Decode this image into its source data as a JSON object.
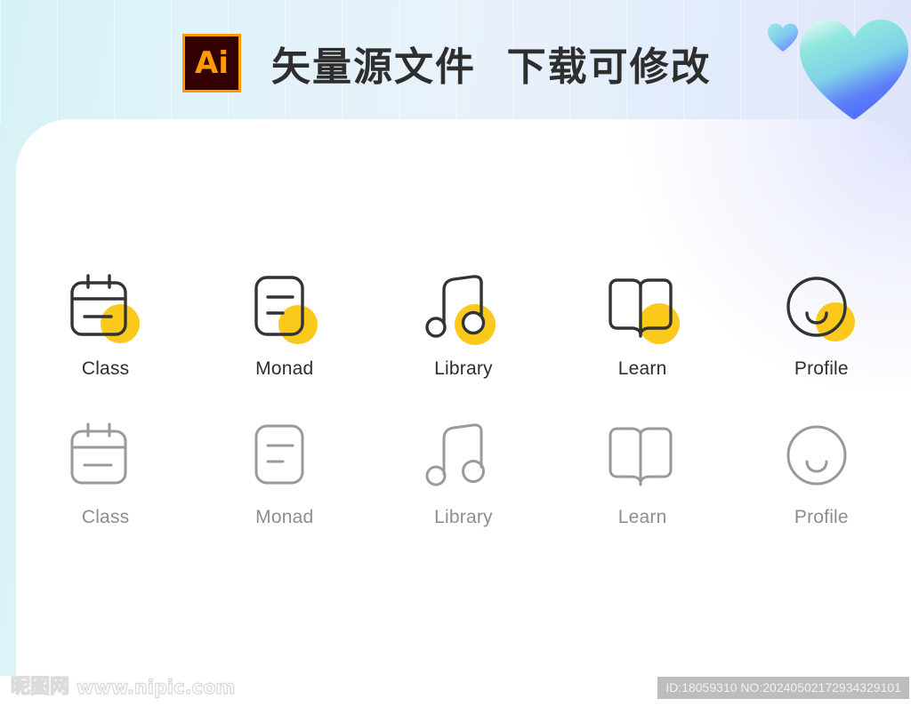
{
  "header": {
    "badge_label": "Ai",
    "title": "矢量源文件  下载可修改",
    "badge_border_color": "#ff9a00",
    "badge_bg_color": "#330000",
    "title_color": "#2e2e2e",
    "decorations": [
      {
        "name": "heart-large",
        "gradient_from": "#7fe3d8",
        "gradient_to": "#4f6dfb"
      },
      {
        "name": "heart-small",
        "gradient_from": "#8fe7de",
        "gradient_to": "#6f8cfb"
      }
    ]
  },
  "background": {
    "gradient_from": "#d6f2f6",
    "gradient_to": "#e2e6fa",
    "card_color": "#ffffff"
  },
  "palette": {
    "accent_yellow": "#fbc91c",
    "icon_dark": "#333333",
    "icon_gray": "#8e8e8e",
    "label_dark": "#2e2e2e",
    "label_gray": "#8e8e8e"
  },
  "icon_rows": [
    {
      "name": "active-row",
      "style": "dark-with-yellow-blob",
      "items": [
        {
          "icon": "calendar-icon",
          "label": "Class"
        },
        {
          "icon": "document-icon",
          "label": "Monad"
        },
        {
          "icon": "music-note-icon",
          "label": "Library"
        },
        {
          "icon": "open-book-icon",
          "label": "Learn"
        },
        {
          "icon": "smiley-face-icon",
          "label": "Profile"
        }
      ]
    },
    {
      "name": "inactive-row",
      "style": "gray-outline",
      "items": [
        {
          "icon": "calendar-icon",
          "label": "Class"
        },
        {
          "icon": "document-icon",
          "label": "Monad"
        },
        {
          "icon": "music-note-icon",
          "label": "Library"
        },
        {
          "icon": "open-book-icon",
          "label": "Learn"
        },
        {
          "icon": "smiley-face-icon",
          "label": "Profile"
        }
      ]
    }
  ],
  "footer": {
    "watermark_cn": "昵图网",
    "watermark_url": "www.nipic.com",
    "id_text": "ID:18059310 NO:20240502172934329101"
  }
}
